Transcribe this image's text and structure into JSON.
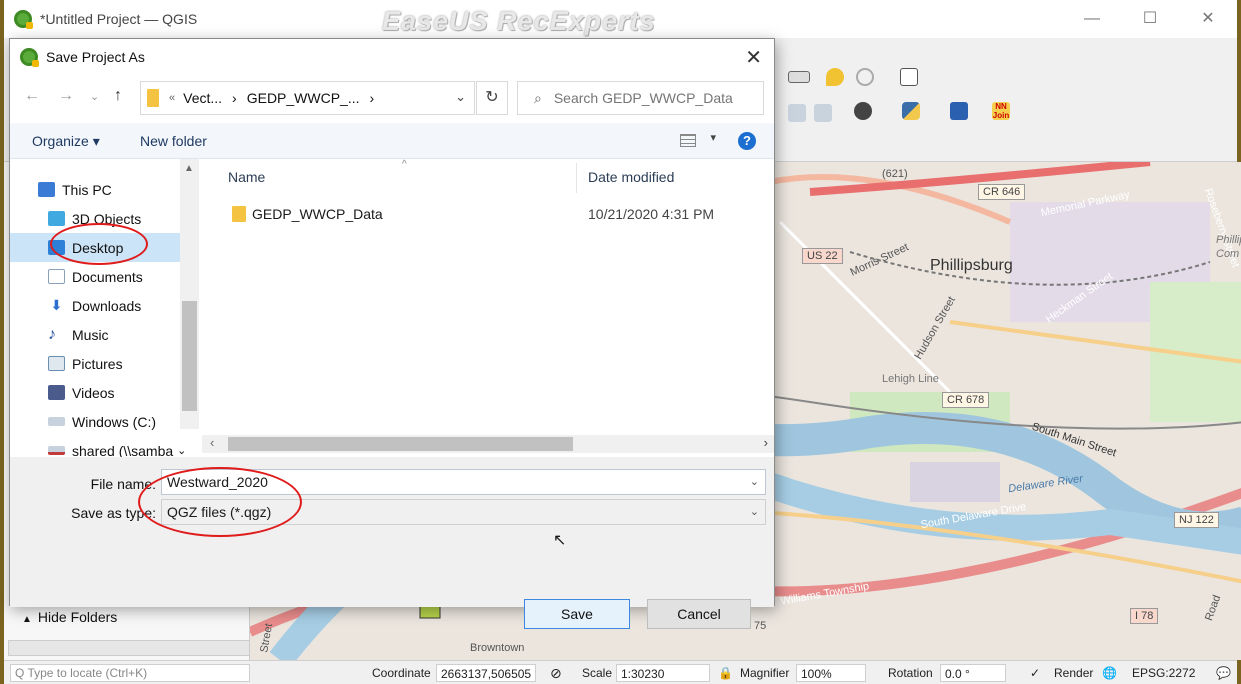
{
  "app": {
    "window_title": "*Untitled Project — QGIS",
    "watermark": "EaseUS RecExperts",
    "min": "—",
    "max": "☐",
    "close": "✕"
  },
  "map_labels": {
    "phillipsburg": "Phillipsburg",
    "memorial_parkway": "Memorial Parkway",
    "cr646": "CR 646",
    "us22": "US 22",
    "n621": "(621)",
    "morris": "Morris Street",
    "hudson": "Hudson Street",
    "heckman": "Heckman Street",
    "lehigh": "Lehigh Line",
    "cr678": "CR 678",
    "south_main": "South Main Street",
    "delaware_river": "Delaware River",
    "south_delaware": "South Delaware Drive",
    "nj122": "NJ 122",
    "williams": "Williams Township",
    "i78": "I 78",
    "browntown": "Browntown",
    "roseberry": "Roseberry Street",
    "phillip_partial": "Phillip",
    "com_partial": "Com",
    "street_partial": "Street",
    "road_partial": "Road",
    "n75": "75"
  },
  "statusbar": {
    "locate_placeholder": "Q Type to locate (Ctrl+K)",
    "coordinate_label": "Coordinate",
    "coordinate_value": "2663137,506505",
    "scale_label": "Scale",
    "scale_value": "1:30230",
    "magnifier_label": "Magnifier",
    "magnifier_value": "100%",
    "rotation_label": "Rotation",
    "rotation_value": "0.0 °",
    "render_label": "Render",
    "crs": "EPSG:2272"
  },
  "dialog": {
    "title": "Save Project As",
    "address": {
      "crumbs": [
        "«",
        "Vect...",
        "›",
        "GEDP_WWCP_...",
        "›"
      ]
    },
    "search_placeholder": "Search GEDP_WWCP_Data",
    "organize_label": "Organize ▾",
    "new_folder_label": "New folder",
    "help_label": "?",
    "nav_items": [
      {
        "label": "This PC",
        "icon": "pc-icon",
        "color": "#3a7bd5"
      },
      {
        "label": "3D Objects",
        "icon": "3d-objects-icon",
        "color": "#3fa9e0"
      },
      {
        "label": "Desktop",
        "icon": "desktop-icon",
        "color": "#2e7fd8"
      },
      {
        "label": "Documents",
        "icon": "documents-icon",
        "color": "#8aa0b8"
      },
      {
        "label": "Downloads",
        "icon": "downloads-icon",
        "color": "#2c6fcf"
      },
      {
        "label": "Music",
        "icon": "music-icon",
        "color": "#1f4f9c"
      },
      {
        "label": "Pictures",
        "icon": "pictures-icon",
        "color": "#6b8fb3"
      },
      {
        "label": "Videos",
        "icon": "videos-icon",
        "color": "#4b5b8c"
      },
      {
        "label": "Windows (C:)",
        "icon": "drive-icon",
        "color": "#7c8fa6"
      },
      {
        "label": "shared (\\\\samba",
        "icon": "network-drive-icon",
        "color": "#c23b3b"
      }
    ],
    "columns": {
      "name": "Name",
      "date": "Date modified"
    },
    "files": [
      {
        "name": "GEDP_WWCP_Data",
        "date": "10/21/2020 4:31 PM"
      }
    ],
    "file_name_label": "File name:",
    "file_name_value": "Westward_2020",
    "save_type_label": "Save as type:",
    "save_type_value": "QGZ files (*.qgz)",
    "hide_folders_label": "Hide Folders",
    "save_label": "Save",
    "cancel_label": "Cancel"
  }
}
